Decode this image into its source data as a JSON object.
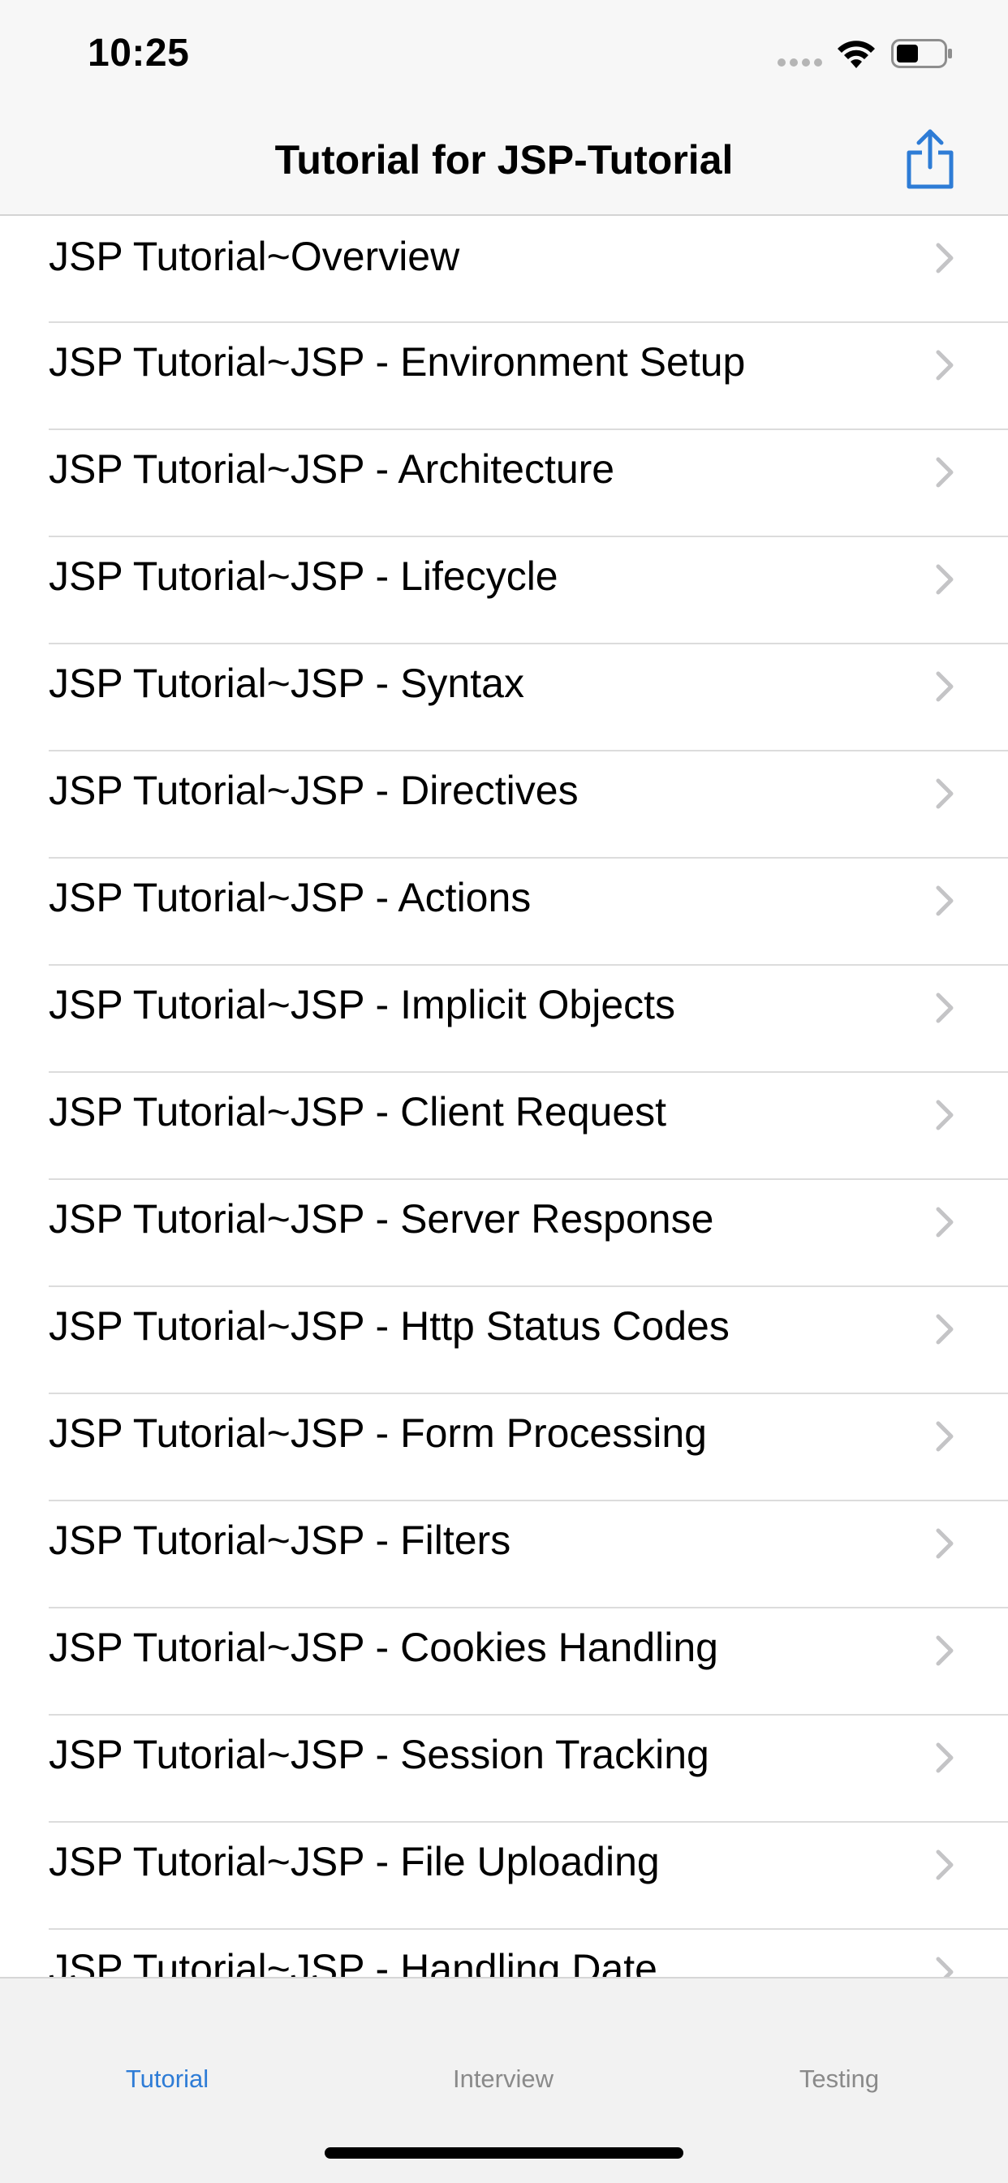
{
  "status_bar": {
    "time": "10:25"
  },
  "nav": {
    "title": "Tutorial for JSP-Tutorial",
    "share_icon": "share-icon",
    "accent": "#2e7cd6"
  },
  "list": {
    "items": [
      {
        "label": "JSP Tutorial~Overview"
      },
      {
        "label": "JSP Tutorial~JSP - Environment Setup"
      },
      {
        "label": "JSP Tutorial~JSP - Architecture"
      },
      {
        "label": "JSP Tutorial~JSP - Lifecycle"
      },
      {
        "label": "JSP Tutorial~JSP - Syntax"
      },
      {
        "label": "JSP Tutorial~JSP - Directives"
      },
      {
        "label": "JSP Tutorial~JSP - Actions"
      },
      {
        "label": "JSP Tutorial~JSP - Implicit Objects"
      },
      {
        "label": "JSP Tutorial~JSP - Client Request"
      },
      {
        "label": "JSP Tutorial~JSP - Server Response"
      },
      {
        "label": "JSP Tutorial~JSP - Http Status Codes"
      },
      {
        "label": "JSP Tutorial~JSP - Form Processing"
      },
      {
        "label": "JSP Tutorial~JSP - Filters"
      },
      {
        "label": "JSP Tutorial~JSP - Cookies Handling"
      },
      {
        "label": "JSP Tutorial~JSP - Session Tracking"
      },
      {
        "label": "JSP Tutorial~JSP - File Uploading"
      },
      {
        "label": "JSP Tutorial~JSP - Handling Date"
      }
    ]
  },
  "tab_bar": {
    "tabs": [
      {
        "label": "Tutorial",
        "selected": true
      },
      {
        "label": "Interview",
        "selected": false
      },
      {
        "label": "Testing",
        "selected": false
      }
    ]
  }
}
